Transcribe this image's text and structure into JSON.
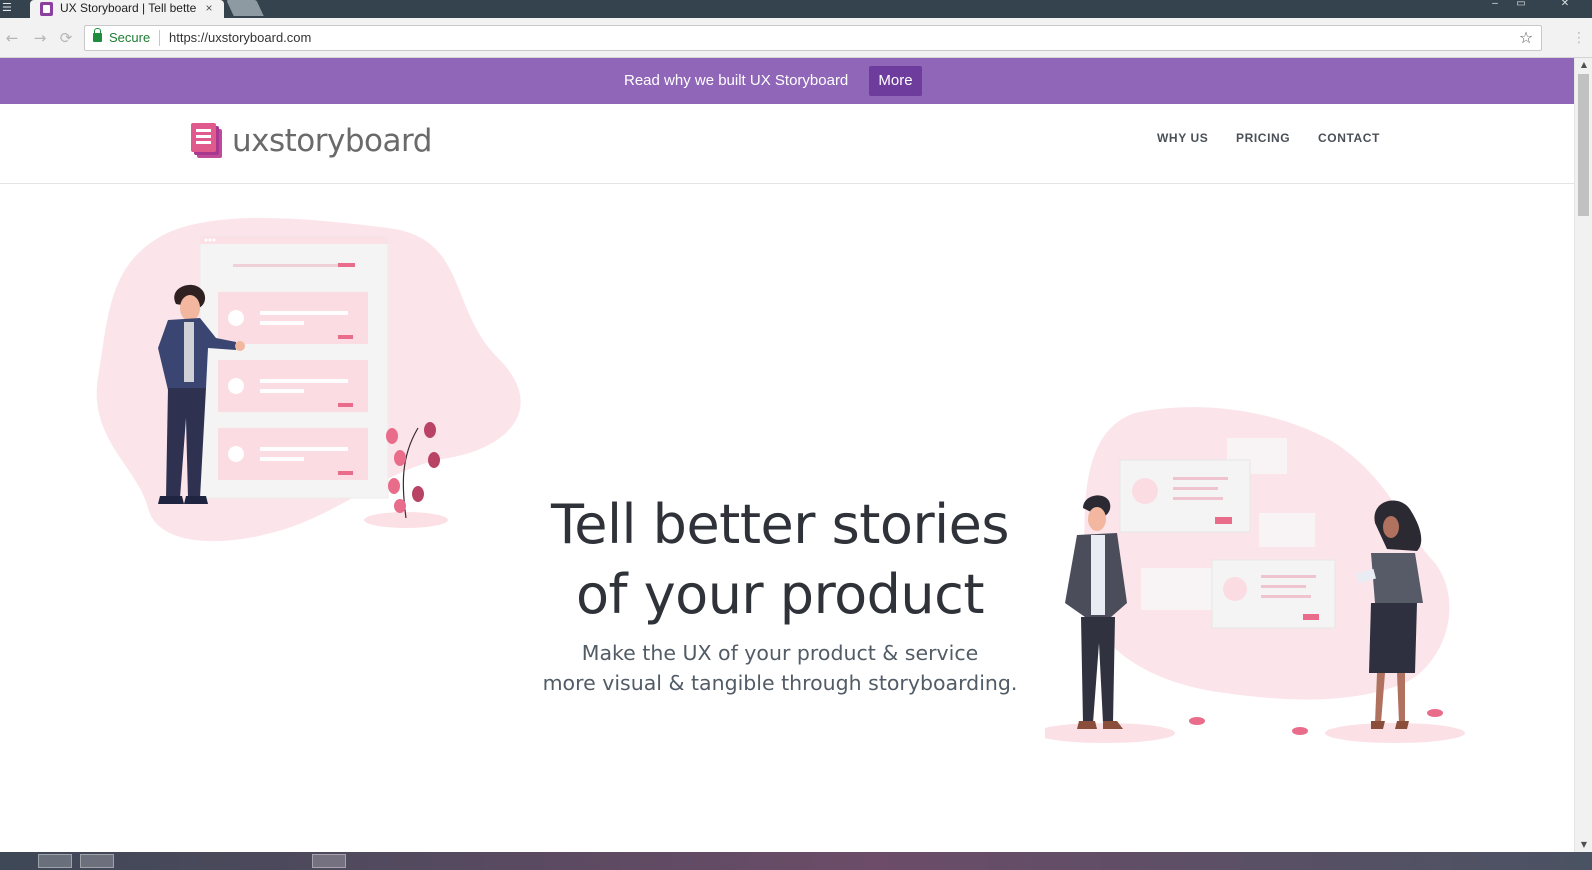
{
  "browser": {
    "tab_title": "UX Storyboard | Tell better stories of your product",
    "tab_close": "×",
    "secure_label": "Secure",
    "url": "https://uxstoryboard.com",
    "menu_glyph": "☰",
    "back_glyph": "←",
    "forward_glyph": "→",
    "reload_glyph": "⟳",
    "star_glyph": "☆",
    "kebab_glyph": "⋮",
    "minimize_glyph": "–",
    "maximize_glyph": "▭",
    "close_glyph": "✕"
  },
  "announcement": {
    "text": "Read why we built UX Storyboard",
    "button_label": "More",
    "background": "#9066b8",
    "button_color": "#6e3c9c"
  },
  "header": {
    "logo_text": "uxstoryboard",
    "nav": [
      "WHY US",
      "PRICING",
      "CONTACT"
    ]
  },
  "hero": {
    "title_line1": "Tell better stories",
    "title_line2": "of your product",
    "subtitle_line1": "Make the UX of your product & service",
    "subtitle_line2": "more visual & tangible through storyboarding."
  },
  "colors": {
    "accent_pink": "#e96d8a",
    "illustration_blush": "#fbe4ea",
    "nav_text": "#4a5057"
  },
  "icons": [
    "menu-icon",
    "favicon",
    "close-icon",
    "lock-icon",
    "star-icon",
    "kebab-icon",
    "logo-icon"
  ]
}
